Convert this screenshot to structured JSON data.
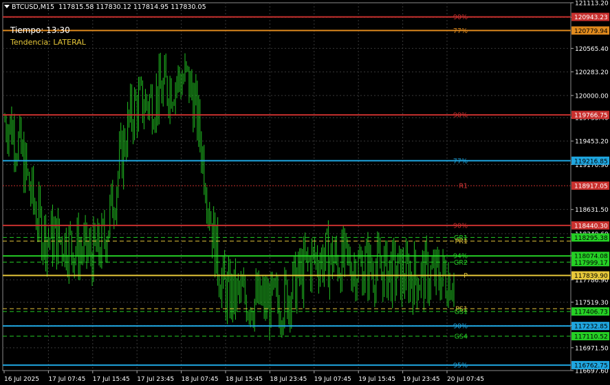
{
  "header": {
    "menu_icon": "triangle-down-icon",
    "symbol_tf": "BTCUSD,M15",
    "ohlc": "117815.58 117830.12 117814.95 117830.05"
  },
  "info": {
    "time_label": "Tiempo: 13:30",
    "trend_label": "Tendencia: LATERAL"
  },
  "colors": {
    "background": "#000000",
    "grid": "#3a3a3a",
    "candles": "#22c422",
    "red_level": "#c8302e",
    "orange_level": "#e08a1e",
    "cyan_level": "#1fa6e0",
    "pivot": "#e8c83a",
    "support_green": "#25d025"
  },
  "price_axis": {
    "ticks": [
      "121113.20",
      "120938.20",
      "120565.40",
      "120283.20",
      "120000.00",
      "119733.40",
      "119453.20",
      "119170.90",
      "118631.50",
      "118340.60",
      "118075.40",
      "117786.90",
      "117519.30",
      "117238.10",
      "116971.50",
      "116697.60"
    ]
  },
  "time_axis": {
    "labels": [
      "16 Jul 2025",
      "17 Jul 07:45",
      "17 Jul 15:45",
      "17 Jul 23:45",
      "18 Jul 07:45",
      "18 Jul 15:45",
      "18 Jul 23:45",
      "19 Jul 07:45",
      "19 Jul 15:45",
      "19 Jul 23:45",
      "20 Jul 07:45"
    ]
  },
  "levels": [
    {
      "price": 120943.23,
      "price_text": "120943.23",
      "tag": "90%",
      "style": "solid",
      "color": "#c8302e",
      "tag_color": "#c8302e",
      "box_color": "#c8302e",
      "box_text": "#ffffff"
    },
    {
      "price": 120779.94,
      "price_text": "120779.94",
      "tag": "77%",
      "style": "solid",
      "color": "#e08a1e",
      "tag_color": "#e08a1e",
      "box_color": "#e08a1e",
      "box_text": "#000000"
    },
    {
      "price": 119766.75,
      "price_text": "119766.75",
      "tag": "90%",
      "style": "solid",
      "color": "#c8302e",
      "tag_color": "#c8302e",
      "box_color": "#c8302e",
      "box_text": "#ffffff"
    },
    {
      "price": 119216.85,
      "price_text": "119216.85",
      "tag": "77%",
      "style": "solid",
      "color": "#1fa6e0",
      "tag_color": "#1fa6e0",
      "box_color": "#1fa6e0",
      "box_text": "#000000"
    },
    {
      "price": 118917.05,
      "price_text": "118917.05",
      "tag": "R1",
      "style": "dotted",
      "color": "#c8302e",
      "tag_color": "#e03a3a",
      "box_color": "#c8302e",
      "box_text": "#ffffff"
    },
    {
      "price": 118440.3,
      "price_text": "118440.30",
      "tag": "90%",
      "style": "solid",
      "color": "#c8302e",
      "tag_color": "#c8302e",
      "box_color": "#c8302e",
      "box_text": "#ffffff"
    },
    {
      "price": 118295.38,
      "price_text": "118295.38",
      "tag": "GR1",
      "style": "dashed",
      "color": "#25d025",
      "tag_color": "#25d025",
      "box_color": "#25d025",
      "box_text": "#000000"
    },
    {
      "price": 118251.57,
      "price_text": "118251.57",
      "tag": "PR1",
      "style": "dashed",
      "color": "#e8c83a",
      "tag_color": "#e8c83a",
      "box_color": null,
      "box_text": null
    },
    {
      "price": 118074.08,
      "price_text": "118074.08",
      "tag": "94%",
      "style": "solid",
      "color": "#25d025",
      "tag_color": "#25d025",
      "box_color": "#25d025",
      "box_text": "#000000"
    },
    {
      "price": 117999.17,
      "price_text": "117999.17",
      "tag": "GR2",
      "style": "dashed",
      "color": "#25d025",
      "tag_color": "#25d025",
      "box_color": "#25d025",
      "box_text": "#000000"
    },
    {
      "price": 117839.9,
      "price_text": "117839.90",
      "tag": "P",
      "style": "solid",
      "color": "#e8c83a",
      "tag_color": "#e8c83a",
      "box_color": "#e8c83a",
      "box_text": "#000000"
    },
    {
      "price": 117440.0,
      "price_text": "",
      "tag": "PS1",
      "style": "dashed",
      "color": "#e8c83a",
      "tag_color": "#e8c83a",
      "box_color": null,
      "box_text": null
    },
    {
      "price": 117406.73,
      "price_text": "117406.73",
      "tag": "GS1",
      "style": "dashed",
      "color": "#25d025",
      "tag_color": "#25d025",
      "box_color": "#25d025",
      "box_text": "#000000"
    },
    {
      "price": 117232.85,
      "price_text": "117232.85",
      "tag": "90%",
      "style": "solid",
      "color": "#1fa6e0",
      "tag_color": "#1fa6e0",
      "box_color": "#1fa6e0",
      "box_text": "#000000"
    },
    {
      "price": 117110.52,
      "price_text": "117110.52",
      "tag": "GS4",
      "style": "dashed",
      "color": "#25d025",
      "tag_color": "#25d025",
      "box_color": "#25d025",
      "box_text": "#000000"
    },
    {
      "price": 116762.75,
      "price_text": "116762.75",
      "tag": "95%",
      "style": "solid",
      "color": "#1fa6e0",
      "tag_color": "#1fa6e0",
      "box_color": "#1fa6e0",
      "box_text": "#000000"
    }
  ],
  "chart_data": {
    "type": "line",
    "title": "BTCUSD,M15",
    "xlabel": "",
    "ylabel": "",
    "ylim": [
      116697.6,
      121113.2
    ],
    "grid": true,
    "x": [
      "16 Jul 2025",
      "17 Jul 07:45",
      "17 Jul 15:45",
      "17 Jul 23:45",
      "18 Jul 07:45",
      "18 Jul 15:45",
      "18 Jul 23:45",
      "19 Jul 07:45",
      "19 Jul 15:45",
      "19 Jul 23:45",
      "20 Jul 07:45"
    ],
    "series": [
      {
        "values": [
          119700,
          118300,
          118100,
          119900,
          120200,
          117600,
          117500,
          118050,
          117950,
          117840,
          117830
        ]
      }
    ]
  }
}
